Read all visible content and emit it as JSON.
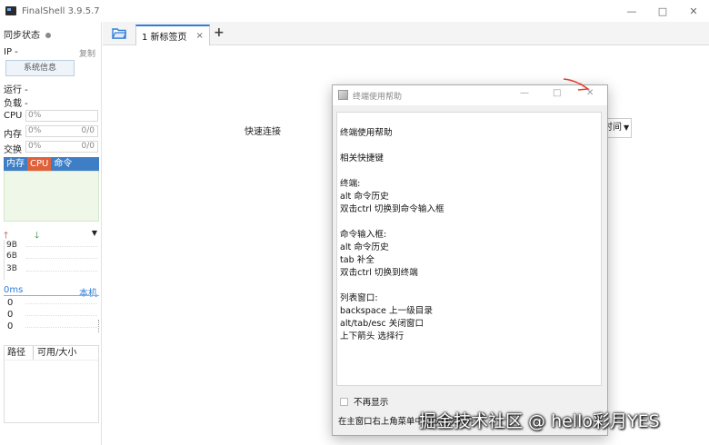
{
  "window": {
    "title": "FinalShell 3.9.5.7",
    "minimize": "—",
    "maximize": "□",
    "close": "✕"
  },
  "sidebar": {
    "sync_status": "同步状态",
    "ip_label": "IP -",
    "copy_label": "复制",
    "sysinfo_button": "系统信息",
    "run_label": "运行 -",
    "load_label": "负载 -",
    "cpu": {
      "label": "CPU",
      "value": "0%"
    },
    "memory": {
      "label": "内存",
      "value": "0%",
      "extra": "0/0"
    },
    "swap": {
      "label": "交换",
      "value": "0%",
      "extra": "0/0"
    },
    "process_tabs": [
      "内存",
      "CPU",
      "命令"
    ],
    "net_ticks": [
      "9B",
      "6B",
      "3B"
    ],
    "ping_label": "0ms",
    "ping_host": "本机",
    "ping_values": [
      "0",
      "0",
      "0"
    ],
    "fs_headers": [
      "路径",
      "可用/大小"
    ]
  },
  "tabs": {
    "items": [
      {
        "label": "1 新标签页",
        "close": "×"
      }
    ],
    "add": "+"
  },
  "main": {
    "quick_connect": "快速连接",
    "behind_combo": "时间"
  },
  "dialog": {
    "title": "终端使用帮助",
    "lines": [
      "终端使用帮助",
      "",
      "相关快捷键",
      "",
      "终端:",
      "alt 命令历史",
      "双击ctrl 切换到命令输入框",
      "",
      "命令输入框:",
      "alt 命令历史",
      "tab 补全",
      "双击ctrl 切换到终端",
      "",
      "列表窗口:",
      "backspace 上一级目录",
      "alt/tab/esc 关闭窗口",
      "上下箭头 选择行"
    ],
    "dont_show": "不再显示",
    "footer": "在主窗口右上角菜单中可以再次打开",
    "minimize": "—",
    "maximize": "□",
    "close": "✕"
  },
  "watermark": "掘金技术社区 @ hello彩月YES",
  "colors": {
    "accent": "#2f7dd6",
    "cpu_tab": "#e0603a",
    "process_tabs": "#3d7ec6",
    "annotation_arrow": "#e23b2e"
  }
}
